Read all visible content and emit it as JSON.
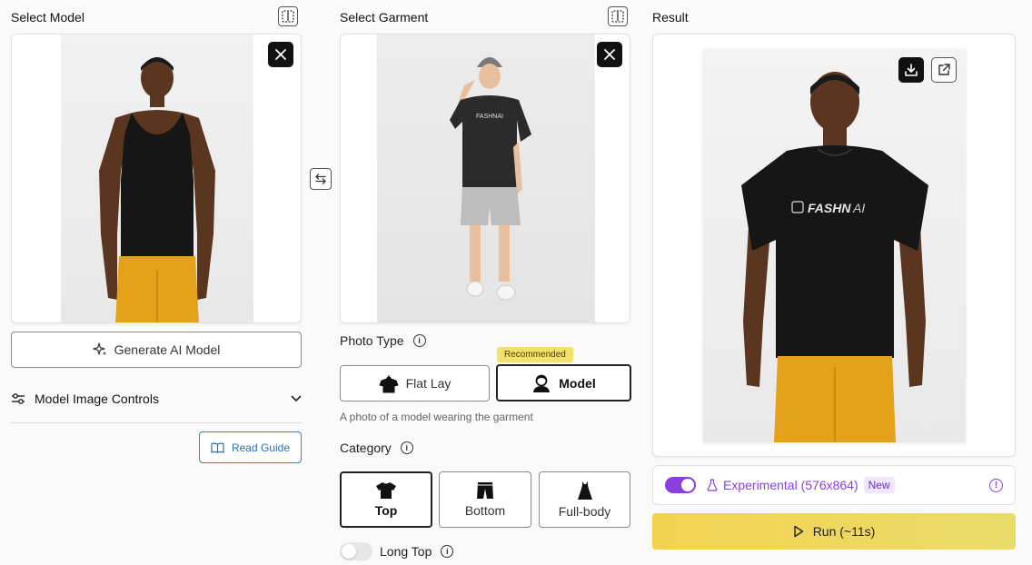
{
  "model_panel": {
    "title": "Select Model",
    "generate_label": "Generate AI Model",
    "controls_label": "Model Image Controls",
    "guide_label": "Read Guide"
  },
  "garment_panel": {
    "title": "Select Garment",
    "photo_type_label": "Photo Type",
    "recommended_badge": "Recommended",
    "photo_types": [
      "Flat Lay",
      "Model"
    ],
    "selected_photo_type": "Model",
    "photo_type_hint": "A photo of a model wearing the garment",
    "category_label": "Category",
    "categories": [
      "Top",
      "Bottom",
      "Full-body"
    ],
    "selected_category": "Top",
    "long_top_label": "Long Top",
    "garment_print": "FASHNAI"
  },
  "result_panel": {
    "title": "Result",
    "experimental_label": "Experimental (576x864)",
    "new_badge": "New",
    "run_label": "Run (~11s)",
    "shirt_print_bold": "FASHN",
    "shirt_print_light": "AI"
  },
  "colors": {
    "accent_purple": "#8b3fe0",
    "run_yellow": "#f3d250",
    "badge_yellow": "#f4e16a"
  }
}
